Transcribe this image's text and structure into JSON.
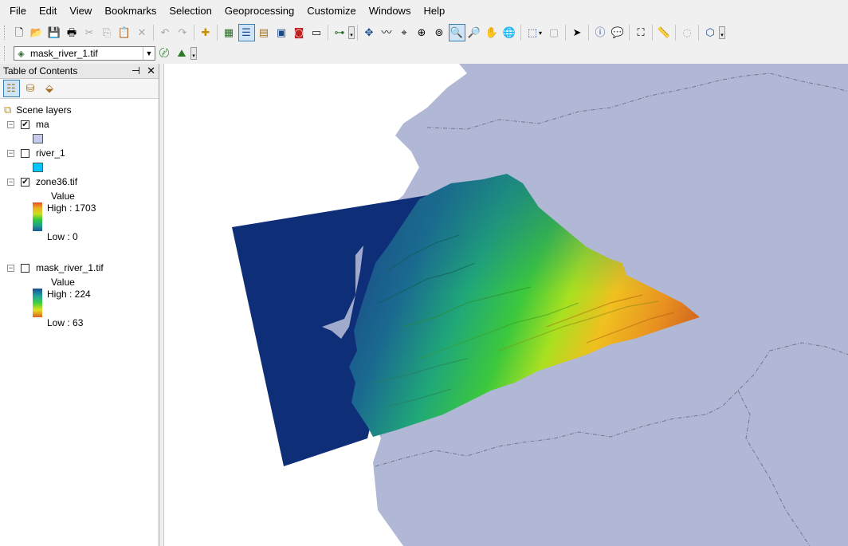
{
  "menu": [
    "File",
    "Edit",
    "View",
    "Bookmarks",
    "Selection",
    "Geoprocessing",
    "Customize",
    "Windows",
    "Help"
  ],
  "toolbar1": {
    "icons": [
      "new-document-icon",
      "open-folder-icon",
      "save-icon",
      "print-icon",
      "cut-icon",
      "copy-icon",
      "paste-icon",
      "delete-icon",
      "undo-icon",
      "redo-icon",
      "add-data-icon",
      "scene-properties-icon",
      "toc-window-icon",
      "catalog-window-icon",
      "search-window-icon",
      "arctoolbox-icon",
      "python-window-icon",
      "model-builder-icon",
      "navigate-icon",
      "fly-icon",
      "target-center-icon",
      "zoom-to-target-icon",
      "set-observer-icon",
      "zoom-in-icon",
      "zoom-out-icon",
      "pan-icon",
      "full-extent-icon",
      "select-features-icon",
      "clear-selection-icon",
      "select-elements-icon",
      "identify-icon",
      "html-popup-icon",
      "find-icon",
      "measure-icon",
      "animation-icon",
      "3d-effects-icon"
    ]
  },
  "toolbar2": {
    "layer_select_value": "mask_river_1.tif"
  },
  "toc": {
    "title": "Table of Contents",
    "root_label": "Scene layers",
    "layers": [
      {
        "name": "ma",
        "checked": true,
        "swatch_color": "#c5cae8"
      },
      {
        "name": "river_1",
        "checked": false,
        "swatch_color": "#00c5ff"
      },
      {
        "name": "zone36.tif",
        "checked": true,
        "value_label": "Value",
        "high": "High : 1703",
        "low": "Low : 0"
      },
      {
        "name": "mask_river_1.tif",
        "checked": false,
        "value_label": "Value",
        "high": "High : 224",
        "low": "Low : 63"
      }
    ]
  },
  "colors": {
    "land": "#b0b8d6",
    "raster_background": "#0e2e78",
    "map_background": "#ffffff"
  }
}
